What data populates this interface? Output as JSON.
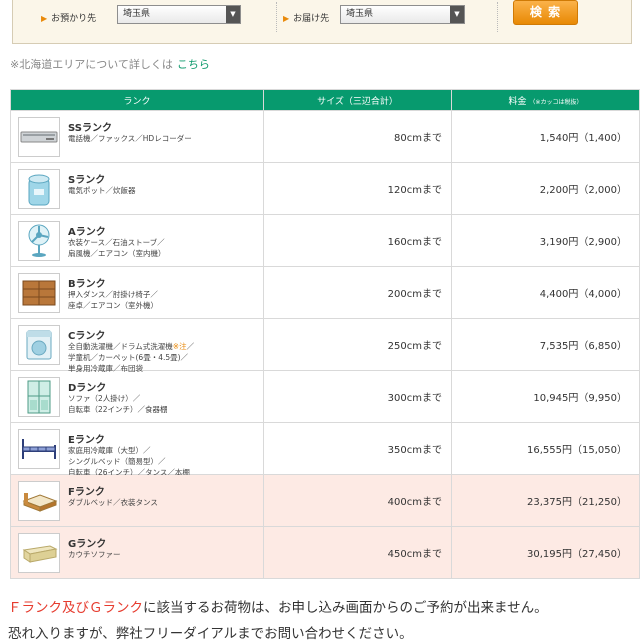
{
  "search": {
    "from_label": "お預かり先",
    "from_value": "埼玉県",
    "to_label": "お届け先",
    "to_value": "埼玉県",
    "submit_label": "検 索"
  },
  "note": {
    "text": "※北海道エリアについて詳しくは",
    "link": "こちら"
  },
  "table": {
    "headers": {
      "rank": "ランク",
      "size": "サイズ（三辺合計）",
      "price": "料金",
      "price_note": "（※カッコは税抜）"
    },
    "rows": [
      {
        "rank": "SSランク",
        "items": [
          "電話機／ファックス／HDレコーダー"
        ],
        "size": "80cmまで",
        "price": "1,540円（1,400）",
        "icon": "hd-recorder-icon"
      },
      {
        "rank": "Sランク",
        "items": [
          "電気ポット／炊飯器"
        ],
        "size": "120cmまで",
        "price": "2,200円（2,000）",
        "icon": "electric-pot-icon"
      },
      {
        "rank": "Aランク",
        "items": [
          "衣装ケース／石油ストーブ／",
          "扇風機／エアコン（室内機）"
        ],
        "size": "160cmまで",
        "price": "3,190円（2,900）",
        "icon": "fan-icon"
      },
      {
        "rank": "Bランク",
        "items": [
          "押入ダンス／肘掛け椅子／",
          "座卓／エアコン（室外機）"
        ],
        "size": "200cmまで",
        "price": "4,400円（4,000）",
        "icon": "chest-icon"
      },
      {
        "rank": "Cランク",
        "items": [
          "全自動洗濯機／ドラム式洗濯機",
          "学童机／カーペット(6畳・4.5畳)／",
          "単身用冷蔵庫／布団袋"
        ],
        "items_note": "※注",
        "items_tail": "／",
        "size": "250cmまで",
        "price": "7,535円（6,850）",
        "icon": "washing-machine-icon"
      },
      {
        "rank": "Dランク",
        "items": [
          "ソファ（2人掛け）／",
          "自転車（22インチ）／食器棚"
        ],
        "size": "300cmまで",
        "price": "10,945円（9,950）",
        "icon": "cupboard-icon"
      },
      {
        "rank": "Eランク",
        "items": [
          "家庭用冷蔵庫（大型）／",
          "シングルベッド（簡易型）／",
          "自転車（26インチ）／タンス／本棚"
        ],
        "size": "350cmまで",
        "price": "16,555円（15,050）",
        "icon": "single-bed-icon"
      },
      {
        "rank": "Fランク",
        "items": [
          "ダブルベッド／衣装タンス"
        ],
        "size": "400cmまで",
        "price": "23,375円（21,250）",
        "icon": "double-bed-icon"
      },
      {
        "rank": "Gランク",
        "items": [
          "カウチソファー"
        ],
        "size": "450cmまで",
        "price": "30,195円（27,450）",
        "icon": "couch-sofa-icon"
      }
    ]
  },
  "footer": {
    "line1_highlight": "Ｆランク及びＧランク",
    "line1_rest": "に該当するお荷物は、お申し込み画面からのご予約が出来ません。",
    "line2": "恐れ入りますが、弊社フリーダイアルまでお問い合わせください。"
  },
  "colors": {
    "header_green": "#079a6e",
    "highlight_red": "#e63b2e",
    "button_orange": "#f3a021",
    "pink_row": "#fdeae4",
    "link_green": "#0e9a6c"
  }
}
